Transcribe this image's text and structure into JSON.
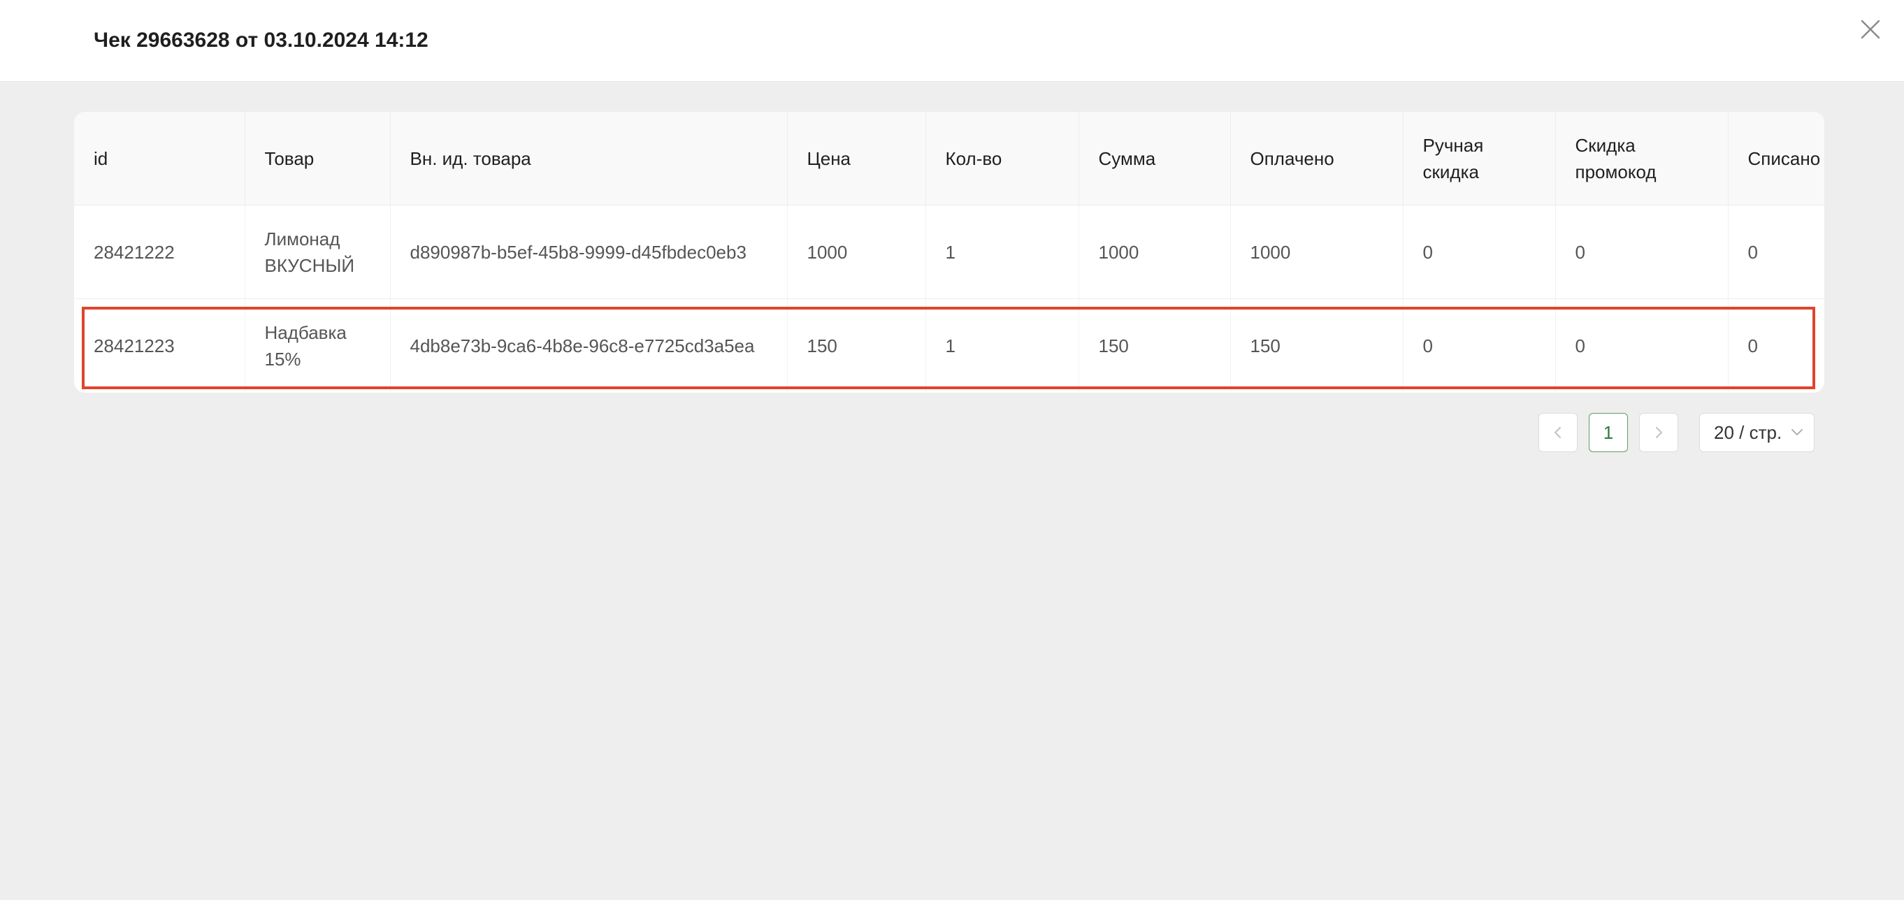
{
  "dialog": {
    "title": "Чек 29663628 от 03.10.2024 14:12",
    "close_icon": "close-icon"
  },
  "table": {
    "columns": [
      "id",
      "Товар",
      "Вн. ид. товара",
      "Цена",
      "Кол-во",
      "Сумма",
      "Оплачено",
      "Ручная скидка",
      "Скидка промокод",
      "Списано"
    ],
    "rows": [
      [
        "28421222",
        "Лимонад ВКУСНЫЙ",
        "d890987b-b5ef-45b8-9999-d45fbdec0eb3",
        "1000",
        "1",
        "1000",
        "1000",
        "0",
        "0",
        "0"
      ],
      [
        "28421223",
        "Надбавка 15%",
        "4db8e73b-9ca6-4b8e-96c8-e7725cd3a5ea",
        "150",
        "1",
        "150",
        "150",
        "0",
        "0",
        "0"
      ]
    ],
    "highlighted_row_index": 1,
    "highlight_color": "#e0442c"
  },
  "pagination": {
    "prev_icon": "chevron-left-icon",
    "current_page": "1",
    "next_icon": "chevron-right-icon",
    "page_size": "20 / стр.",
    "page_size_icon": "chevron-down-icon",
    "active_color": "#2e7d3b"
  }
}
